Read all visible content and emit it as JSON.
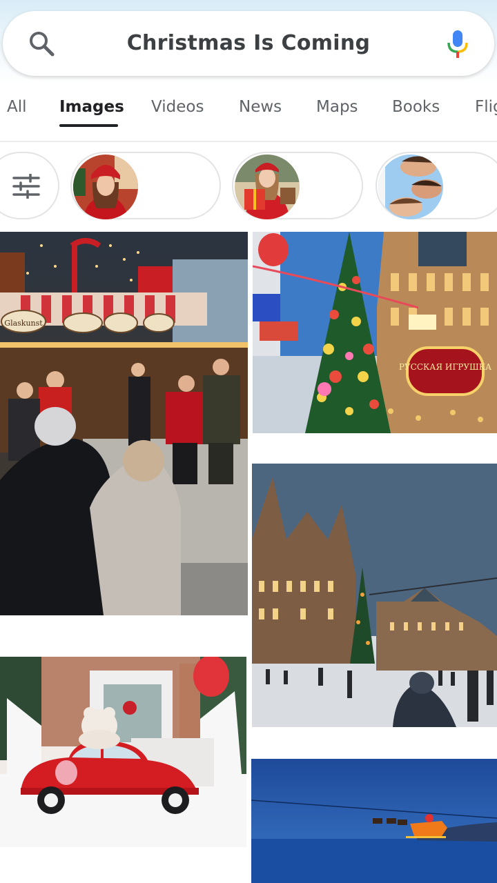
{
  "search": {
    "query": "Christmas Is Coming",
    "search_icon": "search-icon",
    "mic_icon": "mic-icon"
  },
  "tabs": [
    {
      "label": "All",
      "active": false
    },
    {
      "label": "Images",
      "active": true
    },
    {
      "label": "Videos",
      "active": false
    },
    {
      "label": "News",
      "active": false
    },
    {
      "label": "Maps",
      "active": false
    },
    {
      "label": "Books",
      "active": false
    },
    {
      "label": "Flig",
      "active": false
    }
  ],
  "chips": {
    "filter_icon": "tune-icon",
    "items": [
      {
        "name": "chip-woman-red-hat"
      },
      {
        "name": "chip-woman-gifts"
      },
      {
        "name": "chip-family-faces"
      }
    ]
  },
  "images": {
    "sign_left": "Glaskunst",
    "sign_moscow": "РУССКАЯ ИГРУШКА"
  },
  "colors": {
    "accent_text": "#202124",
    "muted_text": "#5f6368",
    "mic_blue": "#4285f4",
    "mic_red": "#ea4335",
    "mic_yellow": "#fbbc04",
    "mic_green": "#34a853"
  }
}
